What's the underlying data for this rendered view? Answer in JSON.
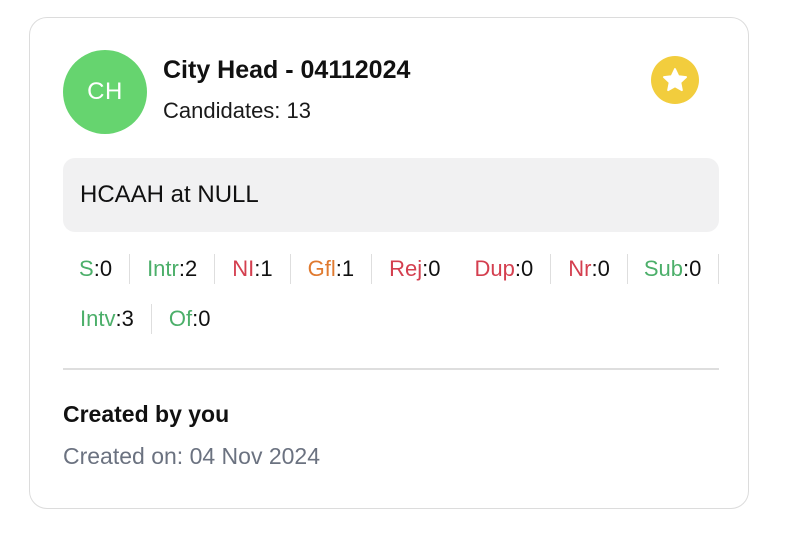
{
  "card": {
    "avatar_initials": "CH",
    "avatar_color": "#66d46f",
    "title": "City Head - 04112024",
    "candidates_text": "Candidates: 13",
    "favorite_icon": "star-icon",
    "favorite_color": "#f2cd3d",
    "description": "HCAAH at NULL",
    "stats": [
      {
        "key": "S",
        "value": "0",
        "color": "#4caf6a"
      },
      {
        "key": "Intr",
        "value": "2",
        "color": "#4caf6a"
      },
      {
        "key": "NI",
        "value": "1",
        "color": "#d43f4f"
      },
      {
        "key": "Gfl",
        "value": "1",
        "color": "#e07a2f"
      },
      {
        "key": "Rej",
        "value": "0",
        "color": "#d43f4f"
      },
      {
        "key": "Dup",
        "value": "0",
        "color": "#d43f4f"
      },
      {
        "key": "Nr",
        "value": "0",
        "color": "#d43f4f"
      },
      {
        "key": "Sub",
        "value": "0",
        "color": "#4caf6a"
      },
      {
        "key": "Intv",
        "value": "3",
        "color": "#4caf6a"
      },
      {
        "key": "Of",
        "value": "0",
        "color": "#4caf6a"
      }
    ],
    "created_by": "Created by you",
    "created_on": "Created on: 04 Nov 2024"
  }
}
